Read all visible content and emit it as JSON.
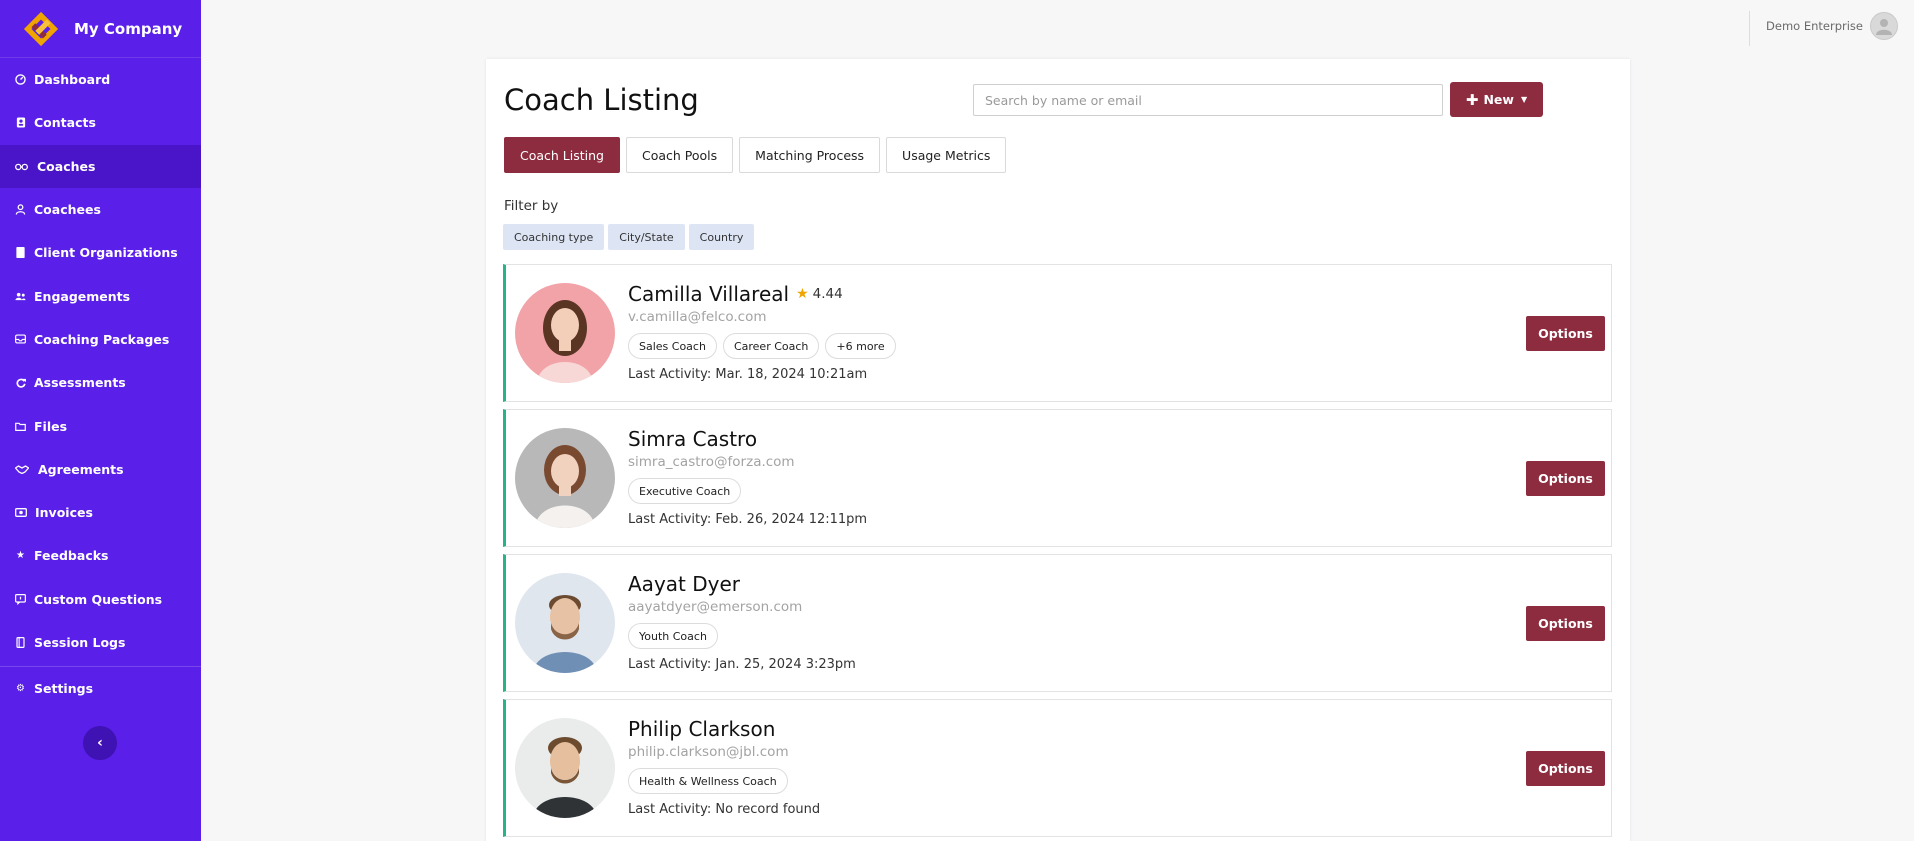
{
  "app": {
    "brand_name": "My Company",
    "brand_colors": [
      "#f0a400",
      "#8e2c3f"
    ]
  },
  "sidebar": {
    "items": [
      {
        "label": "Dashboard",
        "icon": "dashboard-icon"
      },
      {
        "label": "Contacts",
        "icon": "contacts-icon"
      },
      {
        "label": "Coaches",
        "icon": "glasses-icon",
        "active": true
      },
      {
        "label": "Coachees",
        "icon": "user-icon"
      },
      {
        "label": "Client Organizations",
        "icon": "building-icon"
      },
      {
        "label": "Engagements",
        "icon": "users-icon"
      },
      {
        "label": "Coaching Packages",
        "icon": "inbox-icon"
      },
      {
        "label": "Assessments",
        "icon": "refresh-icon"
      },
      {
        "label": "Files",
        "icon": "folder-icon"
      },
      {
        "label": "Agreements",
        "icon": "handshake-icon"
      },
      {
        "label": "Invoices",
        "icon": "money-icon"
      },
      {
        "label": "Feedbacks",
        "icon": "star-icon"
      },
      {
        "label": "Custom Questions",
        "icon": "question-icon"
      },
      {
        "label": "Session Logs",
        "icon": "book-icon"
      }
    ],
    "settings": {
      "label": "Settings",
      "icon": "gear-icon"
    },
    "collapse_icon": "chevron-left-icon"
  },
  "topbar": {
    "user_name": "Demo Enterprise"
  },
  "main": {
    "title": "Coach Listing",
    "search_placeholder": "Search by name or email",
    "new_button_label": "New",
    "tabs": [
      {
        "label": "Coach Listing",
        "active": true
      },
      {
        "label": "Coach Pools"
      },
      {
        "label": "Matching Process"
      },
      {
        "label": "Usage Metrics"
      }
    ],
    "filter_label": "Filter by",
    "filters": [
      "Coaching type",
      "City/State",
      "Country"
    ],
    "options_label": "Options",
    "coaches": [
      {
        "name": "Camilla Villareal",
        "rating": "4.44",
        "email": "v.camilla@felco.com",
        "tags": [
          "Sales Coach",
          "Career Coach",
          "+6 more"
        ],
        "last_activity": "Last Activity: Mar. 18, 2024 10:21am"
      },
      {
        "name": "Simra Castro",
        "email": "simra_castro@forza.com",
        "tags": [
          "Executive Coach"
        ],
        "last_activity": "Last Activity: Feb. 26, 2024 12:11pm"
      },
      {
        "name": "Aayat Dyer",
        "email": "aayatdyer@emerson.com",
        "tags": [
          "Youth Coach"
        ],
        "last_activity": "Last Activity: Jan. 25, 2024 3:23pm"
      },
      {
        "name": "Philip Clarkson",
        "email": "philip.clarkson@jbl.com",
        "tags": [
          "Health & Wellness Coach"
        ],
        "last_activity": "Last Activity: No record found"
      }
    ]
  }
}
